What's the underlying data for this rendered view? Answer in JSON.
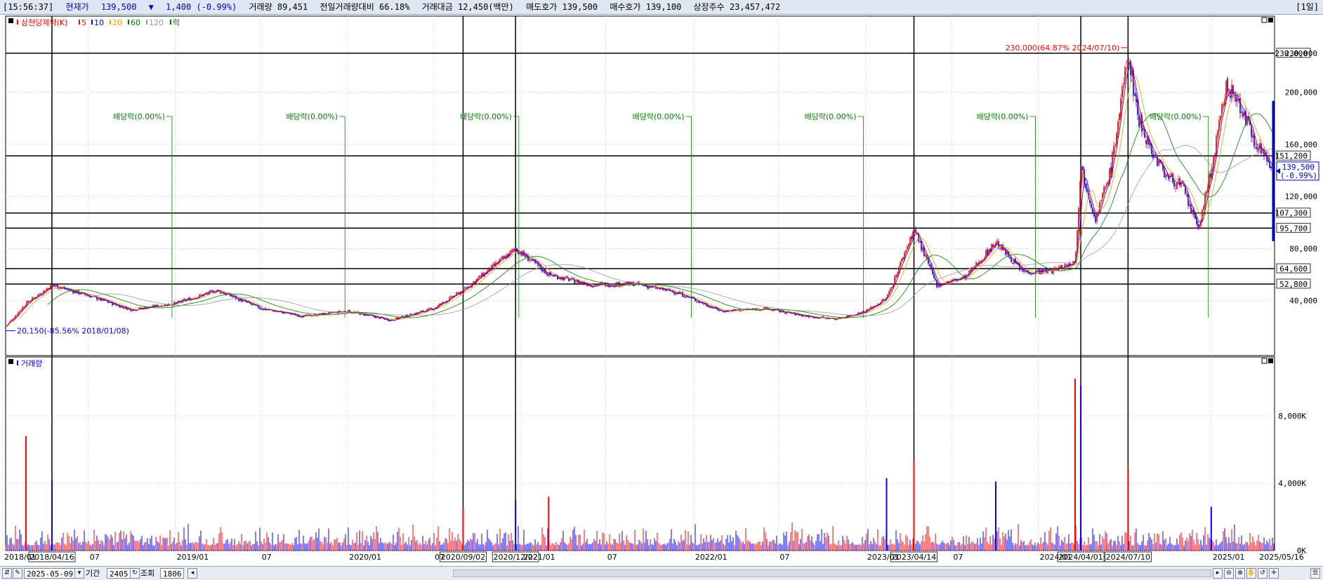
{
  "header": {
    "time": "[15:56:37]",
    "price_label": "현재가",
    "price": "139,500",
    "change_arrow": "▼",
    "change": "1,400",
    "change_pct": "(-0.99%)",
    "volume_label": "거래량",
    "volume": "89,451",
    "prev_ratio_label": "전일거래량대비",
    "prev_ratio": "66.18%",
    "amount_label": "거래대금",
    "amount": "12,450(백만)",
    "ask_label": "매도호가",
    "ask": "139,500",
    "bid_label": "매수호가",
    "bid": "139,100",
    "shares_label": "상장주수",
    "shares": "23,457,472",
    "period": "[1일]"
  },
  "legend": {
    "name": "삼천당제약(K)",
    "ma": [
      {
        "label": "5",
        "color": "#ff0000"
      },
      {
        "label": "10",
        "color": "#0000ff"
      },
      {
        "label": "20",
        "color": "#ff9900"
      },
      {
        "label": "60",
        "color": "#008000"
      },
      {
        "label": "120",
        "color": "#999999"
      }
    ],
    "ex_div_label": "락",
    "volume_title": "거래량"
  },
  "colors": {
    "up": "#ff0000",
    "down": "#0000ff",
    "ex_div": "#008000",
    "current_price": "#0000d0"
  },
  "chart_data": [
    {
      "type": "line",
      "title": "삼천당제약(K)",
      "ylim": [
        0,
        245000
      ],
      "y_ticks": [
        "40,000",
        "80,000",
        "120,000",
        "160,000",
        "200,000",
        "230,000"
      ],
      "x_ticks": [
        "2018/01",
        "07",
        "2019/01",
        "07",
        "2020/01",
        "07",
        "2021/01",
        "07",
        "2022/01",
        "07",
        "2023/01",
        "07",
        "2024/01",
        "2025/01",
        "2025/05/16"
      ],
      "series": [
        {
          "x": [
            "2018/01/08",
            "2018/02/20",
            "2018/04/16",
            "2018/07/01",
            "2018/10/01",
            "2019/01/02",
            "2019/04/01",
            "2019/07/01",
            "2019/10/01",
            "2020/01/02",
            "2020/04/01",
            "2020/07/01",
            "2020/09/02",
            "2020/12/22",
            "2021/03/02",
            "2021/06/01",
            "2021/09/01",
            "2021/12/01",
            "2022/03/02",
            "2022/06/02",
            "2022/09/01",
            "2022/11/01",
            "2023/01/02",
            "2023/02/15",
            "2023/04/14",
            "2023/06/01",
            "2023/08/01",
            "2023/10/04",
            "2023/12/01",
            "2024/02/01",
            "2024/03/20",
            "2024/04/01",
            "2024/05/02",
            "2024/06/03",
            "2024/07/10",
            "2024/08/01",
            "2024/09/02",
            "2024/10/02",
            "2024/11/01",
            "2024/12/05",
            "2025/01/02",
            "2025/02/03",
            "2025/03/04",
            "2025/04/01",
            "2025/05/16"
          ],
          "values": [
            20150,
            38000,
            52000,
            44000,
            33000,
            38000,
            48000,
            34000,
            28000,
            32000,
            25000,
            34000,
            48000,
            80000,
            60000,
            52000,
            53000,
            46000,
            32000,
            34000,
            28000,
            26000,
            32000,
            42000,
            95000,
            52000,
            58000,
            85000,
            62000,
            63000,
            70000,
            143000,
            103000,
            140000,
            230000,
            180000,
            152000,
            135000,
            128000,
            95000,
            140000,
            205000,
            190000,
            165000,
            139500
          ]
        }
      ],
      "annotations": [
        {
          "x": "2018/12/26",
          "text": "배당락(0.00%)"
        },
        {
          "x": "2019/12/27",
          "text": "배당락(0.00%)"
        },
        {
          "x": "2020/12/29",
          "text": "배당락(0.00%)"
        },
        {
          "x": "2021/12/29",
          "text": "배당락(0.00%)"
        },
        {
          "x": "2022/12/28",
          "text": "배당락(0.00%)"
        },
        {
          "x": "2023/12/27",
          "text": "배당락(0.00%)"
        },
        {
          "x": "2024/12/27",
          "text": "배당락(0.00%)"
        }
      ],
      "max_label": "230,000(64.87% 2024/07/10)",
      "min_label": "20,150(-85.56% 2018/01/08)",
      "hlines": [
        "230,000",
        "151,200",
        "107,300",
        "95,700",
        "64,600",
        "52,800"
      ],
      "vlines": [
        "2018/04/16",
        "2020/09/02",
        "2020/12/22",
        "2023/04/14",
        "2024/04/01",
        "2024/07/10"
      ],
      "current": {
        "price": "139,500",
        "pct": "(-0.99%)"
      }
    },
    {
      "type": "bar",
      "title": "거래량",
      "ylim": [
        0,
        11000
      ],
      "y_ticks": [
        "0K",
        "4,000K",
        "8,000K"
      ],
      "series": [
        {
          "x": [
            "2018/02/20",
            "2018/04/16",
            "2020/09/02",
            "2020/12/22",
            "2021/03/02",
            "2023/02/15",
            "2023/04/14",
            "2023/10/04",
            "2024/03/20",
            "2024/04/01",
            "2024/07/10",
            "2025/01/02"
          ],
          "values": [
            6800,
            4200,
            2500,
            3000,
            3200,
            4300,
            5300,
            4100,
            10200,
            9800,
            4800,
            2600
          ]
        }
      ]
    }
  ],
  "footer": {
    "date": "2025-05-09",
    "period_label": "기간",
    "period": "2405",
    "view_label": "조회",
    "view": "1806"
  }
}
